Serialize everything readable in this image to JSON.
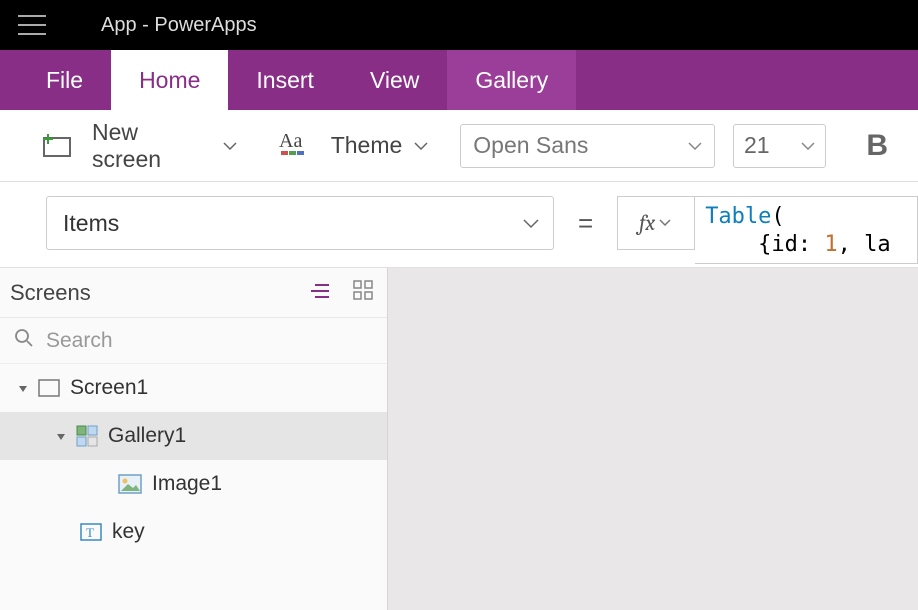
{
  "titlebar": {
    "text": "App - PowerApps"
  },
  "tabs": {
    "file": "File",
    "home": "Home",
    "insert": "Insert",
    "view": "View",
    "gallery": "Gallery"
  },
  "ribbon": {
    "new_screen": "New screen",
    "theme": "Theme",
    "font_name": "Open Sans",
    "font_size": "21",
    "bold": "B"
  },
  "formula": {
    "property": "Items",
    "formula_keyword": "Table",
    "formula_line1_rest": "(",
    "formula_line2_pre": "    {id: ",
    "formula_line2_num": "1",
    "formula_line2_rest": ", la"
  },
  "tree": {
    "panel_title": "Screens",
    "search_placeholder": "Search",
    "items": [
      {
        "label": "Screen1"
      },
      {
        "label": "Gallery1"
      },
      {
        "label": "Image1"
      },
      {
        "label": "key"
      }
    ]
  }
}
